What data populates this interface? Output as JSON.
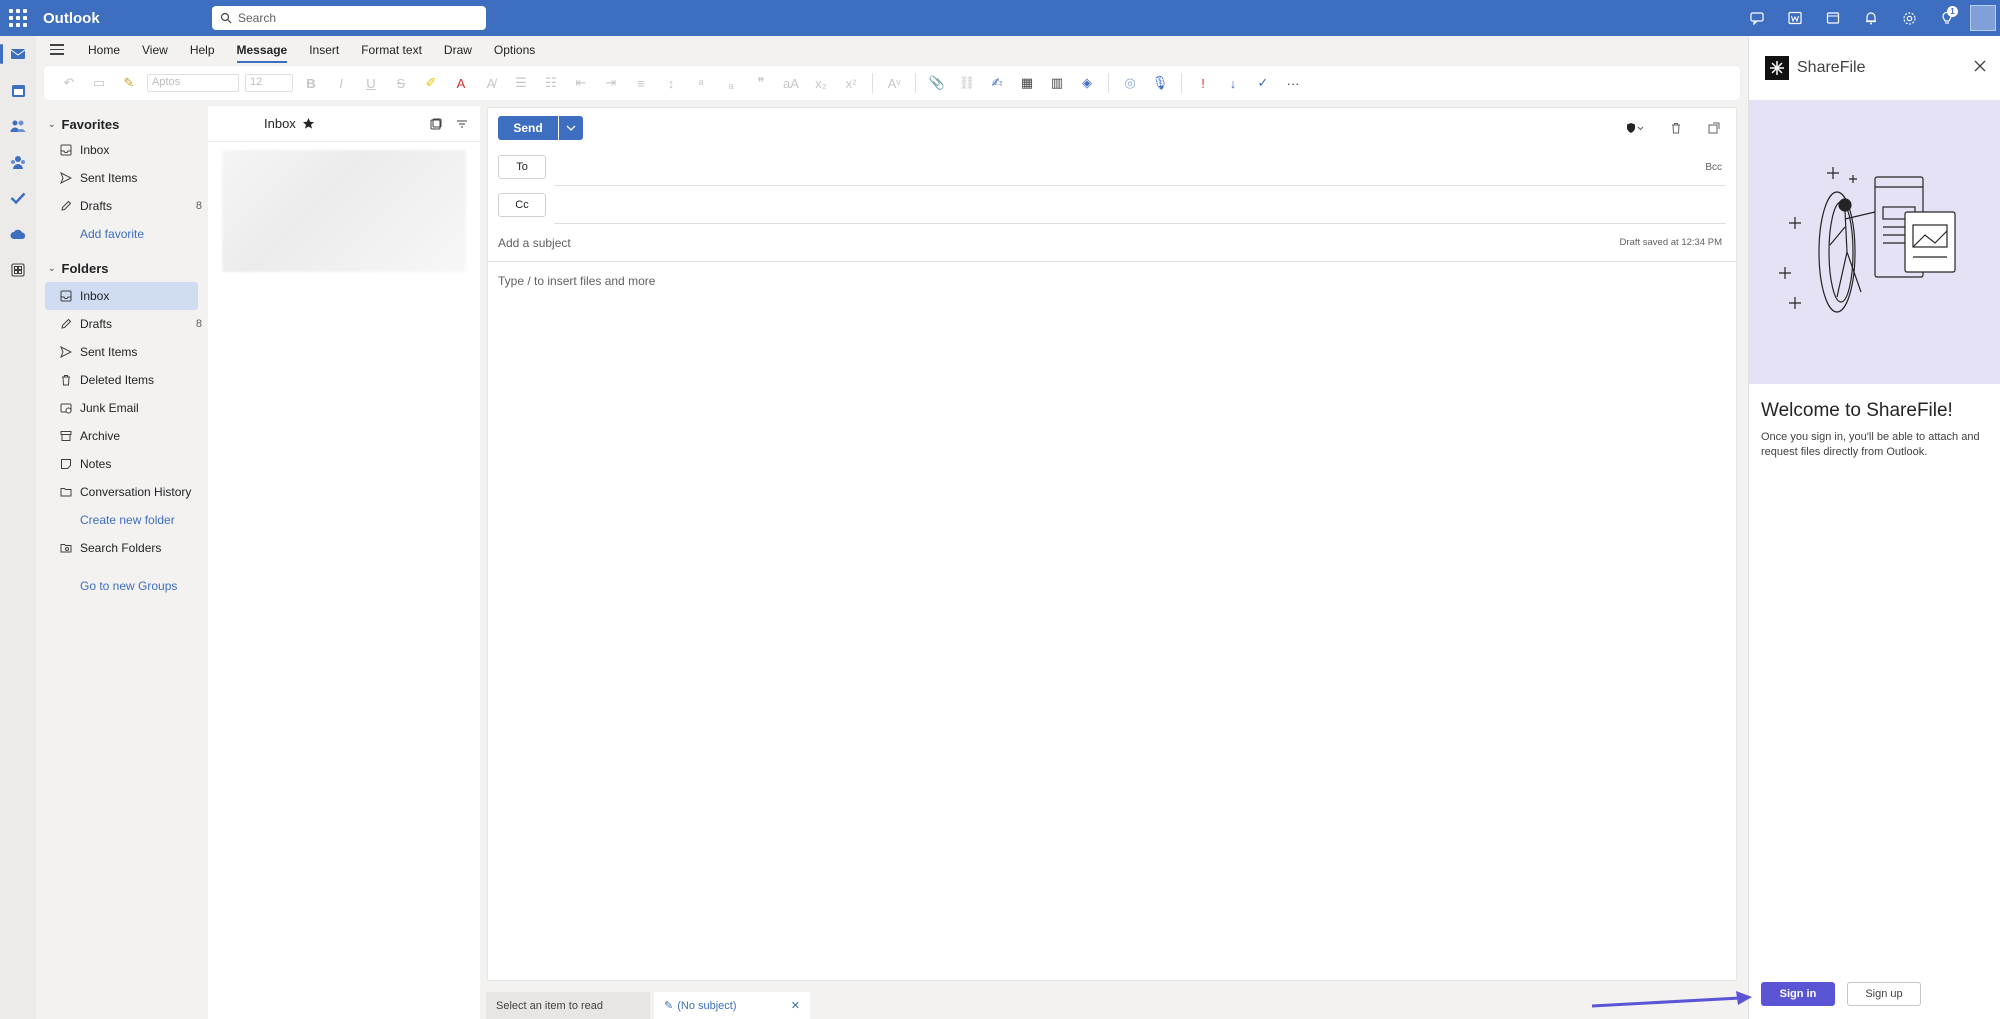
{
  "app": {
    "title": "Outlook",
    "accent": "#3e6ec0"
  },
  "search": {
    "placeholder": "Search"
  },
  "topbar": {
    "notification_count": "1"
  },
  "ribbon": {
    "tabs": [
      "Home",
      "View",
      "Help",
      "Message",
      "Insert",
      "Format text",
      "Draw",
      "Options"
    ],
    "active_tab": "Message",
    "font_name": "Aptos",
    "font_size": "12"
  },
  "favorites": {
    "label": "Favorites",
    "items": [
      {
        "label": "Inbox",
        "count": ""
      },
      {
        "label": "Sent Items",
        "count": ""
      },
      {
        "label": "Drafts",
        "count": "8"
      }
    ],
    "add_label": "Add favorite"
  },
  "folders": {
    "label": "Folders",
    "items": [
      {
        "label": "Inbox",
        "count": ""
      },
      {
        "label": "Drafts",
        "count": "8"
      },
      {
        "label": "Sent Items",
        "count": ""
      },
      {
        "label": "Deleted Items",
        "count": ""
      },
      {
        "label": "Junk Email",
        "count": ""
      },
      {
        "label": "Archive",
        "count": ""
      },
      {
        "label": "Notes",
        "count": ""
      },
      {
        "label": "Conversation History",
        "count": ""
      }
    ],
    "create_label": "Create new folder",
    "search_folders": "Search Folders",
    "groups_link": "Go to new Groups"
  },
  "message_list": {
    "title": "Inbox"
  },
  "compose": {
    "send_label": "Send",
    "to_label": "To",
    "cc_label": "Cc",
    "bcc_label": "Bcc",
    "subject_placeholder": "Add a subject",
    "draft_status": "Draft saved at 12:34 PM",
    "body_placeholder": "Type / to insert files and more"
  },
  "bottom_tabs": {
    "read_label": "Select an item to read",
    "draft_label": "(No subject)"
  },
  "sharefile": {
    "name": "ShareFile",
    "welcome": "Welcome to ShareFile!",
    "description": "Once you sign in, you'll be able to attach and request files directly from Outlook.",
    "sign_in": "Sign in",
    "sign_up": "Sign up",
    "brand_color": "#5b55d6"
  }
}
